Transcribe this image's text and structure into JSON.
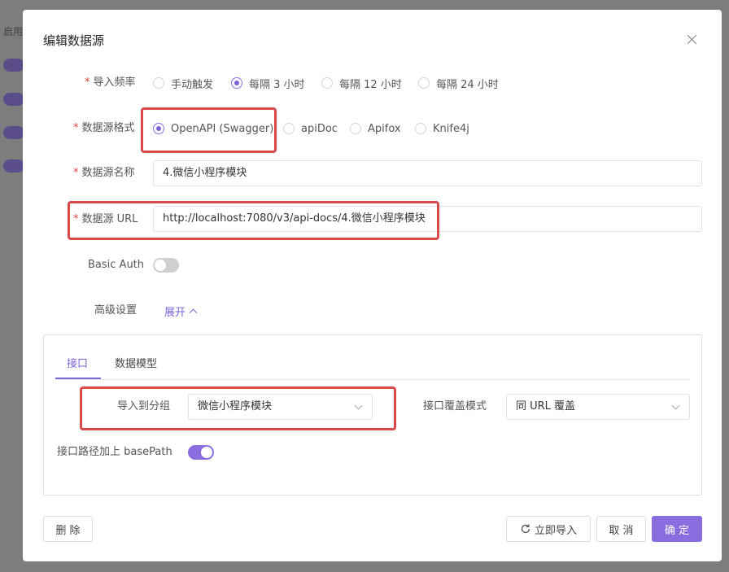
{
  "background": {
    "label": "启用"
  },
  "dialog": {
    "title": "编辑数据源",
    "frequency": {
      "label": "导入频率",
      "options": [
        "手动触发",
        "每隔 3 小时",
        "每隔 12 小时",
        "每隔 24 小时"
      ],
      "selected": "每隔 3 小时"
    },
    "format": {
      "label": "数据源格式",
      "options": [
        "OpenAPI (Swagger)",
        "apiDoc",
        "Apifox",
        "Knife4j"
      ],
      "selected": "OpenAPI (Swagger)"
    },
    "name": {
      "label": "数据源名称",
      "value": "4.微信小程序模块"
    },
    "url": {
      "label": "数据源 URL",
      "value": "http://localhost:7080/v3/api-docs/4.微信小程序模块"
    },
    "basic_auth": {
      "label": "Basic Auth",
      "enabled": false
    },
    "advanced": {
      "label": "高级设置",
      "toggle_label": "展开"
    },
    "panel": {
      "tabs": [
        "接口",
        "数据模型"
      ],
      "active_tab": "接口",
      "group": {
        "label": "导入到分组",
        "value": "微信小程序模块"
      },
      "override": {
        "label": "接口覆盖模式",
        "value": "同 URL 覆盖"
      },
      "base_path": {
        "label": "接口路径加上 basePath",
        "enabled": true
      }
    },
    "footer": {
      "delete_label": "删 除",
      "import_now_label": "立即导入",
      "cancel_label": "取 消",
      "confirm_label": "确 定"
    }
  },
  "colors": {
    "accent": "#8a6ee0",
    "highlight": "#d94949",
    "required": "#e04343"
  }
}
